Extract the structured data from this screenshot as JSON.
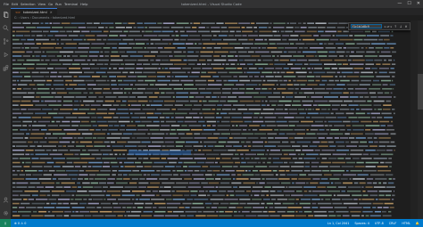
{
  "window": {
    "title": "tokenized.html - Visual Studio Code",
    "menu": [
      "File",
      "Edit",
      "Selection",
      "View",
      "Go",
      "Run",
      "Terminal",
      "Help"
    ]
  },
  "tabs": [
    {
      "label": "tokenized.html"
    }
  ],
  "breadcrumb": "C: › Users › Documents › tokenized.html",
  "find": {
    "value": "f1c1b1d8c9",
    "count": "1 of 1"
  },
  "statusbar": {
    "left": [
      "⊗ 0  ⚠ 0"
    ],
    "right": [
      "Ln 1, Col 2041",
      "Spaces: 4",
      "UTF-8",
      "CRLF",
      "HTML",
      "🔔"
    ]
  },
  "colors": {
    "accent": "#007acc",
    "background": "#1e1e1e",
    "text": "#9aa6b2",
    "selection": "#2864c8"
  },
  "icons": [
    "explorer-icon",
    "search-icon",
    "source-control-icon",
    "run-debug-icon",
    "extensions-icon",
    "account-icon",
    "settings-icon"
  ]
}
